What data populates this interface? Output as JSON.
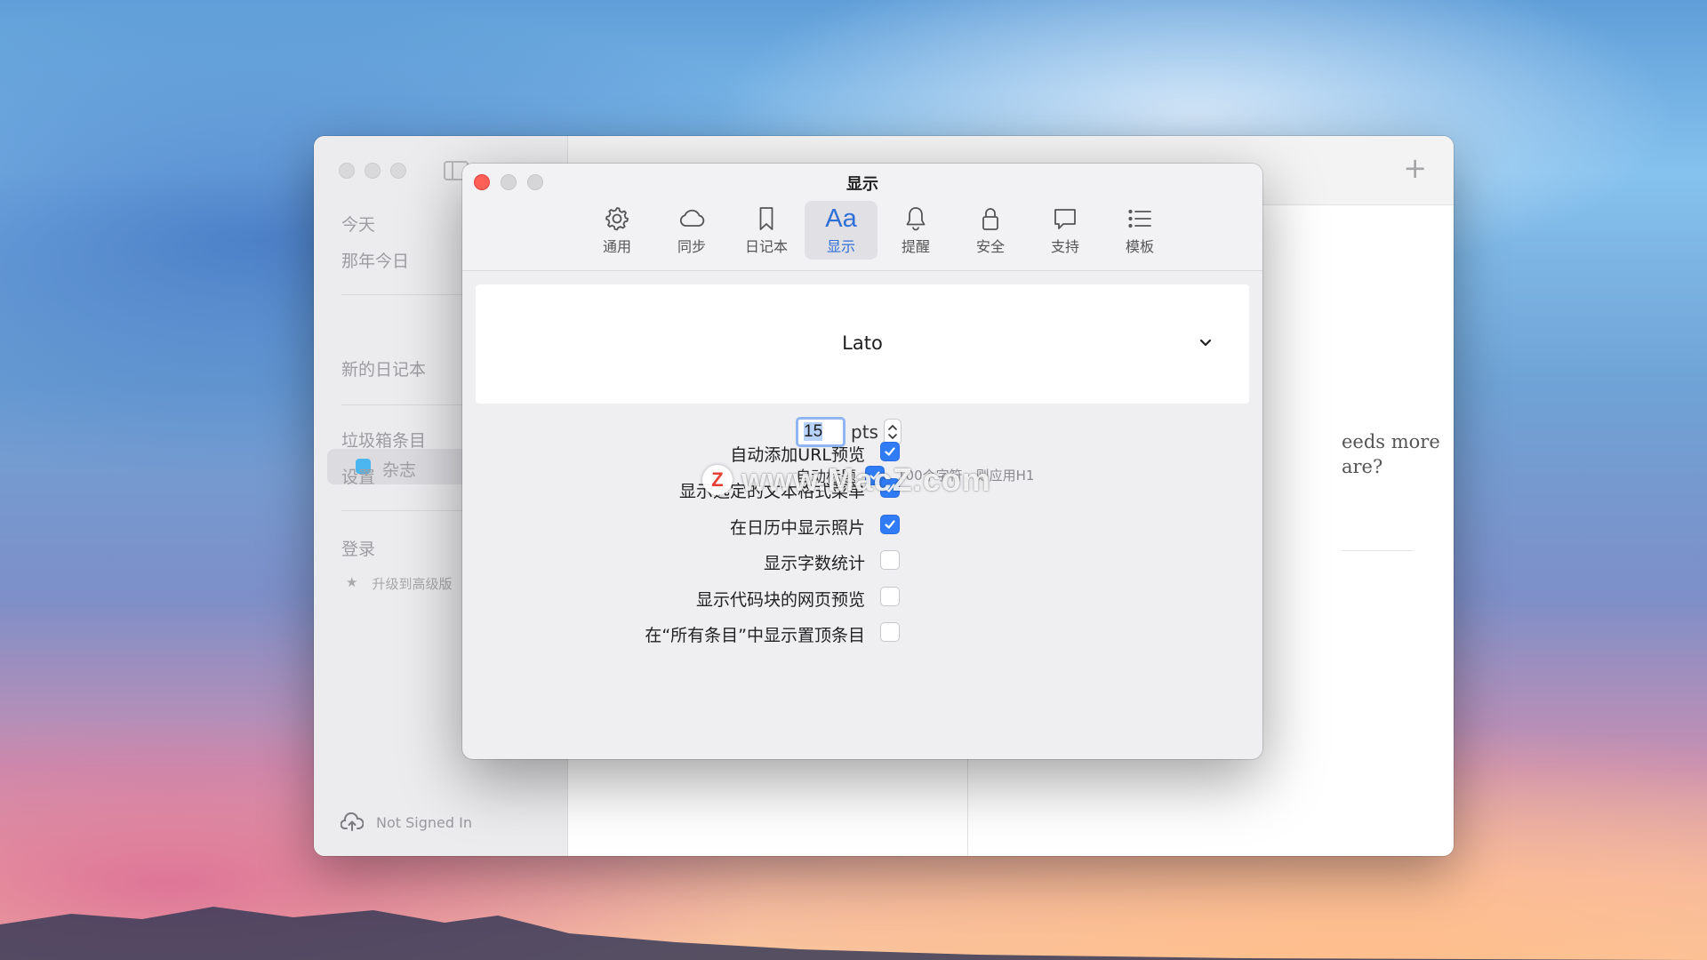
{
  "app": {
    "sidebar": {
      "today": "今天",
      "on_this_day": "那年今日",
      "journal": "杂志",
      "new_journal": "新的日记本",
      "trash": "垃圾箱条目",
      "settings": "设置",
      "login": "登录",
      "upgrade_star": "★",
      "upgrade": "升级到高级版",
      "not_signed_in": "Not Signed In",
      "journal_color": "#4cb6f1"
    },
    "editor": {
      "prompt_line1": "eeds more",
      "prompt_line2": "are?",
      "add_icon": "+"
    }
  },
  "prefs": {
    "title": "显示",
    "tabs": [
      {
        "label": "通用",
        "icon": "gear-icon"
      },
      {
        "label": "同步",
        "icon": "cloud-icon"
      },
      {
        "label": "日记本",
        "icon": "bookmark-icon"
      },
      {
        "label": "显示",
        "icon": "text-aa-icon",
        "glyph": "Aa",
        "active": true
      },
      {
        "label": "提醒",
        "icon": "bell-icon"
      },
      {
        "label": "安全",
        "icon": "lock-icon"
      },
      {
        "label": "支持",
        "icon": "chat-bubble-icon"
      },
      {
        "label": "模板",
        "icon": "list-icon"
      }
    ],
    "font": {
      "selected": "Lato"
    },
    "size": {
      "value": "15",
      "unit": "pts"
    },
    "auto_title": {
      "label": "自动标题",
      "hint": "100个字符，则应用H1",
      "checked": true
    },
    "options": [
      {
        "label": "自动添加URL预览",
        "checked": true
      },
      {
        "label": "显示选定的文本格式菜单",
        "checked": true
      },
      {
        "label": "在日历中显示照片",
        "checked": true
      },
      {
        "label": "显示字数统计",
        "checked": false
      },
      {
        "label": "显示代码块的网页预览",
        "checked": false
      },
      {
        "label": "在“所有条目”中显示置顶条目",
        "checked": false
      }
    ],
    "accent_color": "#2f7cf6"
  },
  "watermark": {
    "logo": "Z",
    "text": "www.MacZ.com"
  }
}
